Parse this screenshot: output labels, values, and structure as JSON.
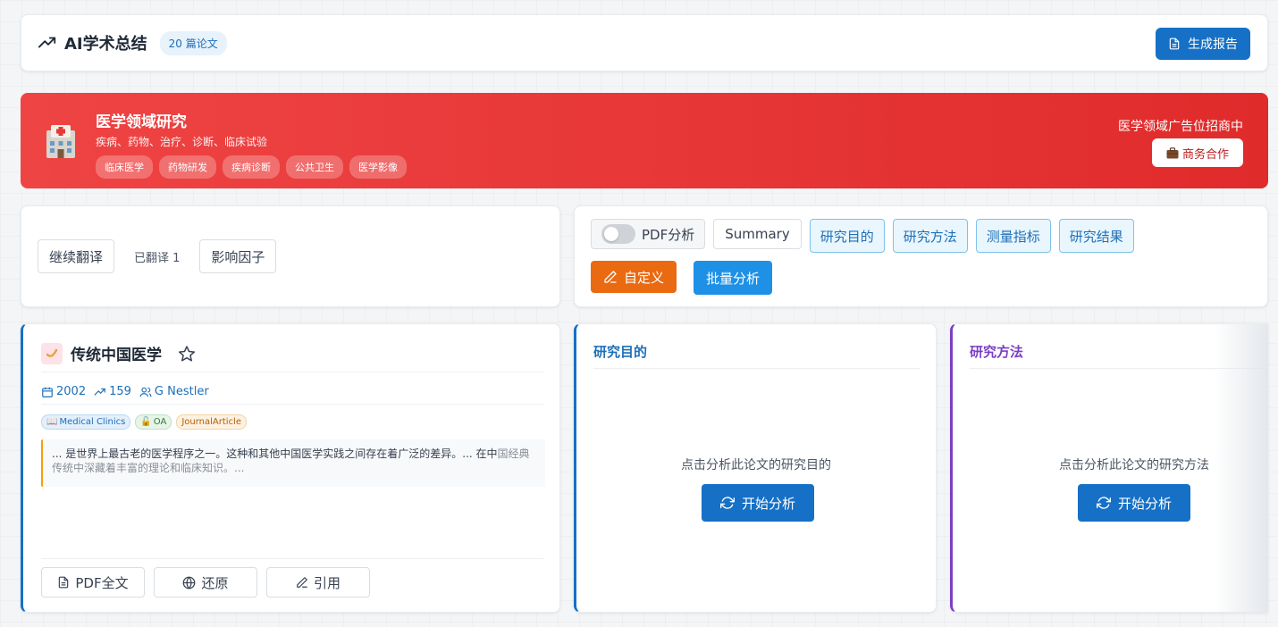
{
  "header": {
    "title": "AI学术总结",
    "paper_count": "20 篇论文",
    "generate_report": "生成报告"
  },
  "banner": {
    "title": "医学领域研究",
    "subtitle": "疾病、药物、治疗、诊断、临床试验",
    "tags": [
      "临床医学",
      "药物研发",
      "疾病诊断",
      "公共卫生",
      "医学影像"
    ],
    "ad_text": "医学领域广告位招商中",
    "business_button": "商务合作",
    "color": "#e53935"
  },
  "left_toolbar": {
    "continue_translate": "继续翻译",
    "translated_count": "已翻译 1",
    "impact_factor": "影响因子"
  },
  "right_toolbar": {
    "pdf_toggle_label": "PDF分析",
    "pdf_toggle_on": false,
    "summary": "Summary",
    "aspects": [
      "研究目的",
      "研究方法",
      "测量指标",
      "研究结果"
    ],
    "custom": "自定义",
    "batch": "批量分析"
  },
  "paper": {
    "title": "传统中国医学",
    "year": "2002",
    "citations": "159",
    "author": "G Nestler",
    "tags": {
      "journal": "Medical Clinics",
      "access": "OA",
      "type": "JournalArticle"
    },
    "abstract_main": "... 是世界上最古老的医学程序之一。这种和其他中国医学实践之间存在着广泛的差异。... 在中",
    "abstract_rest": "国经典传统中深藏着丰富的理论和临床知识。...",
    "buttons": {
      "pdf": "PDF全文",
      "restore": "还原",
      "cite": "引用"
    }
  },
  "analysis": {
    "purpose": {
      "title": "研究目的",
      "hint": "点击分析此论文的研究目的",
      "button": "开始分析"
    },
    "method": {
      "title": "研究方法",
      "hint": "点击分析此论文的研究方法",
      "button": "开始分析"
    }
  },
  "colors": {
    "primary": "#1570c6",
    "accent_orange": "#ea6a12",
    "method_purple": "#7b3fc4"
  }
}
